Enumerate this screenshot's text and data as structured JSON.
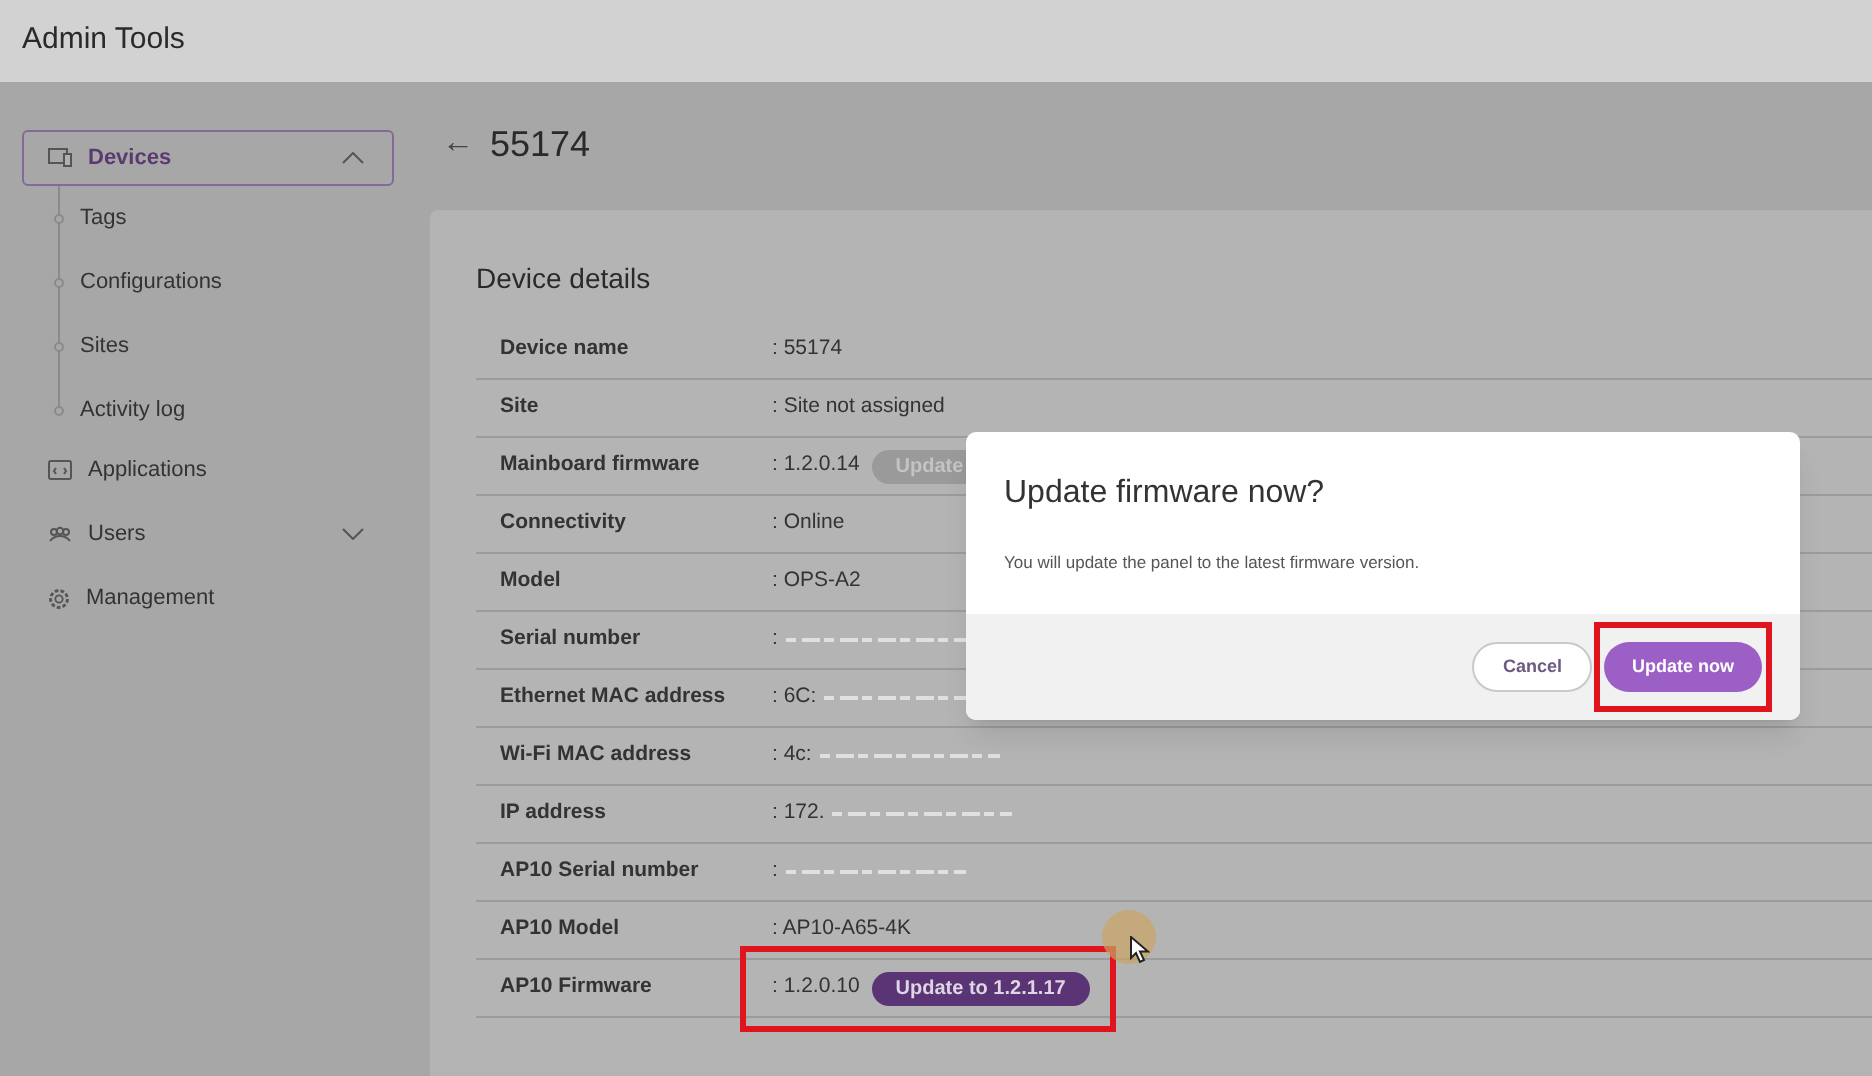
{
  "header": {
    "title": "Admin Tools"
  },
  "sidebar": {
    "items": [
      {
        "label": "Devices",
        "kind": "devices",
        "selected": true,
        "expanded": true,
        "children": [
          {
            "label": "Tags"
          },
          {
            "label": "Configurations"
          },
          {
            "label": "Sites"
          },
          {
            "label": "Activity log"
          }
        ]
      },
      {
        "label": "Applications",
        "kind": "apps",
        "selected": false
      },
      {
        "label": "Users",
        "kind": "users",
        "selected": false,
        "expanded": false
      },
      {
        "label": "Management",
        "kind": "gear",
        "selected": false
      }
    ]
  },
  "page": {
    "back": "←",
    "title": "55174"
  },
  "card": {
    "title": "Device details",
    "rows": [
      {
        "label": "Device name",
        "value": ": 55174"
      },
      {
        "label": "Site",
        "value": ": Site not assigned"
      },
      {
        "label": "Mainboard firmware",
        "value": ": 1.2.0.14",
        "action": {
          "label": "Update",
          "disabled": true
        }
      },
      {
        "label": "Connectivity",
        "value": ": Online"
      },
      {
        "label": "Model",
        "value": ": OPS-A2"
      },
      {
        "label": "Serial number",
        "value": ":",
        "redacted": true
      },
      {
        "label": "Ethernet MAC address",
        "value": ": 6C:",
        "redacted": true
      },
      {
        "label": "Wi-Fi MAC address",
        "value": ": 4c:",
        "redacted": true
      },
      {
        "label": "IP address",
        "value": ": 172.",
        "redacted": true
      },
      {
        "label": "AP10 Serial number",
        "value": ":",
        "redacted": true
      },
      {
        "label": "AP10 Model",
        "value": ": AP10-A65-4K"
      },
      {
        "label": "AP10 Firmware",
        "value": ": 1.2.0.10",
        "action": {
          "label": "Update to 1.2.1.17",
          "disabled": false,
          "highlighted": true
        }
      }
    ]
  },
  "dialog": {
    "title": "Update firmware now?",
    "message": "You will update the panel to the latest firmware version.",
    "cancel": "Cancel",
    "confirm": {
      "label": "Update now",
      "highlighted": true
    }
  }
}
